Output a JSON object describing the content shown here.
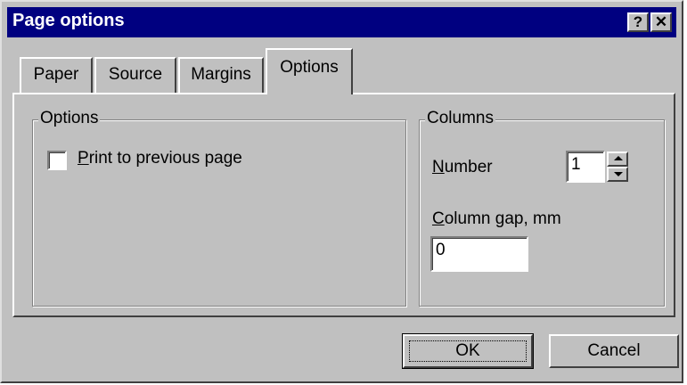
{
  "window": {
    "title": "Page options",
    "help_glyph": "?",
    "close_glyph": "✕"
  },
  "tabs": [
    {
      "label": "Paper"
    },
    {
      "label": "Source"
    },
    {
      "label": "Margins"
    },
    {
      "label": "Options",
      "active": true
    }
  ],
  "options_group": {
    "legend": "Options",
    "print_to_previous_page": {
      "label_hotkey": "P",
      "label_rest": "rint to previous page",
      "checked": false
    }
  },
  "columns_group": {
    "legend": "Columns",
    "number": {
      "label_hotkey": "N",
      "label_rest": "umber",
      "value": "1"
    },
    "column_gap": {
      "label_hotkey": "C",
      "label_rest": "olumn gap, mm",
      "value": "0"
    }
  },
  "buttons": {
    "ok": "OK",
    "cancel": "Cancel"
  },
  "colors": {
    "title_bar": "#000080",
    "face": "#c0c0c0"
  }
}
